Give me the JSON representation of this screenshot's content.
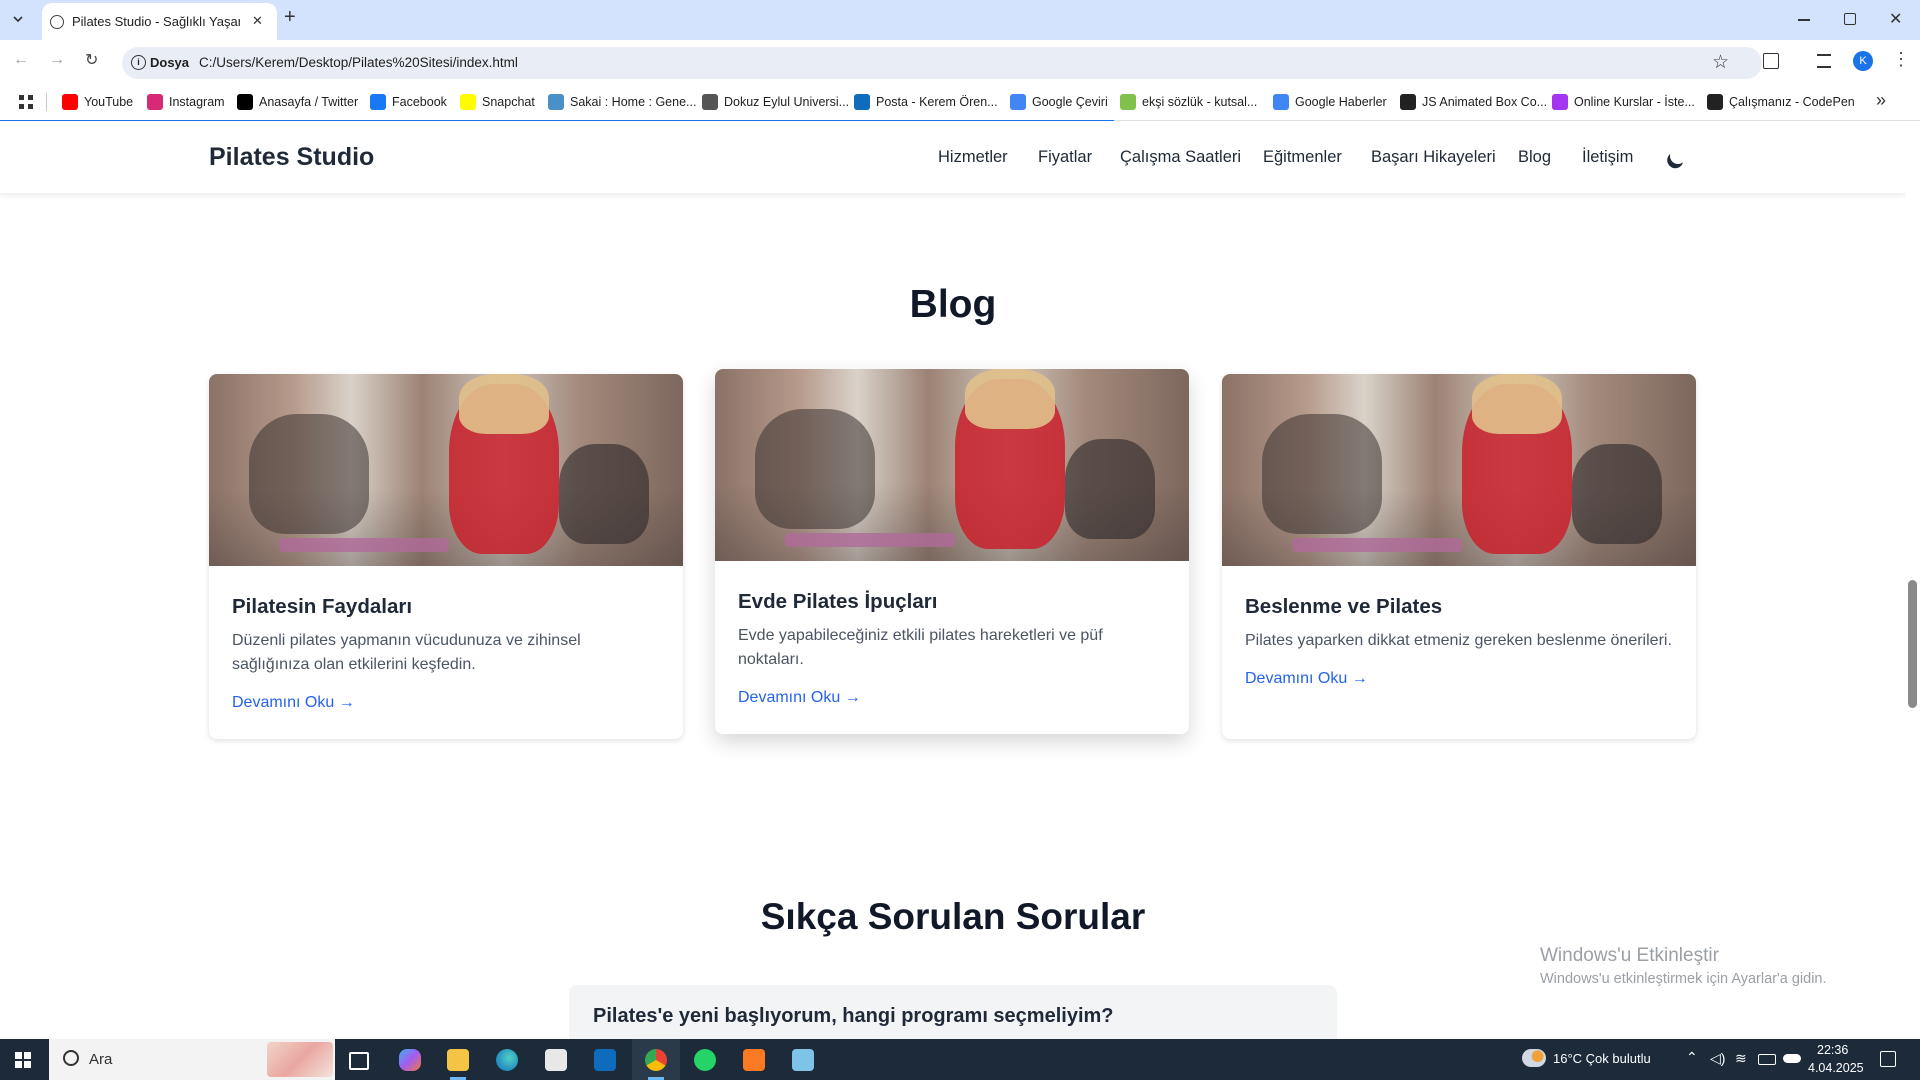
{
  "browser": {
    "tab_title": "Pilates Studio - Sağlıklı Yaşamın",
    "tab_close": "✕",
    "new_tab": "+",
    "address_chip": "Dosya",
    "url": "C:/Users/Kerem/Desktop/Pilates%20Sitesi/index.html",
    "profile_initial": "K",
    "bookmarks": [
      {
        "label": "YouTube",
        "color": "#ff0000"
      },
      {
        "label": "Instagram",
        "color": "#d62976"
      },
      {
        "label": "Anasayfa / Twitter",
        "color": "#000000"
      },
      {
        "label": "Facebook",
        "color": "#1877f2"
      },
      {
        "label": "Snapchat",
        "color": "#fffc00"
      },
      {
        "label": "Sakai : Home : Gene...",
        "color": "#4a90c8"
      },
      {
        "label": "Dokuz Eylul Universi...",
        "color": "#555555"
      },
      {
        "label": "Posta - Kerem Ören...",
        "color": "#0f6cbd"
      },
      {
        "label": "Google Çeviri",
        "color": "#4285f4"
      },
      {
        "label": "ekşi sözlük - kutsal...",
        "color": "#81c14b"
      },
      {
        "label": "Google Haberler",
        "color": "#4285f4"
      },
      {
        "label": "JS Animated Box Co...",
        "color": "#222222"
      },
      {
        "label": "Online Kurslar - İste...",
        "color": "#a435f0"
      },
      {
        "label": "Çalışmanız - CodePen",
        "color": "#222222"
      }
    ],
    "more_bookmarks": "»"
  },
  "site": {
    "brand": "Pilates Studio",
    "nav": [
      "Hizmetler",
      "Fiyatlar",
      "Çalışma Saatleri",
      "Eğitmenler",
      "Başarı Hikayeleri",
      "Blog",
      "İletişim"
    ],
    "blog_title": "Blog",
    "cards": [
      {
        "title": "Pilatesin Faydaları",
        "text": "Düzenli pilates yapmanın vücudunuza ve zihinsel sağlığınıza olan etkilerini keşfedin.",
        "link": "Devamını Oku →"
      },
      {
        "title": "Evde Pilates İpuçları",
        "text": "Evde yapabileceğiniz etkili pilates hareketleri ve püf noktaları.",
        "link": "Devamını Oku →"
      },
      {
        "title": "Beslenme ve Pilates",
        "text": "Pilates yaparken dikkat etmeniz gereken beslenme önerileri.",
        "link": "Devamını Oku →"
      }
    ],
    "faq_title": "Sıkça Sorulan Sorular",
    "faq_first_question": "Pilates'e yeni başlıyorum, hangi programı seçmeliyim?"
  },
  "watermark": {
    "line1": "Windows'u Etkinleştir",
    "line2": "Windows'u etkinleştirmek için Ayarlar'a gidin."
  },
  "taskbar": {
    "search_placeholder": "Ara",
    "weather": "16°C  Çok bulutlu",
    "time": "22:36",
    "date": "4.04.2025"
  }
}
